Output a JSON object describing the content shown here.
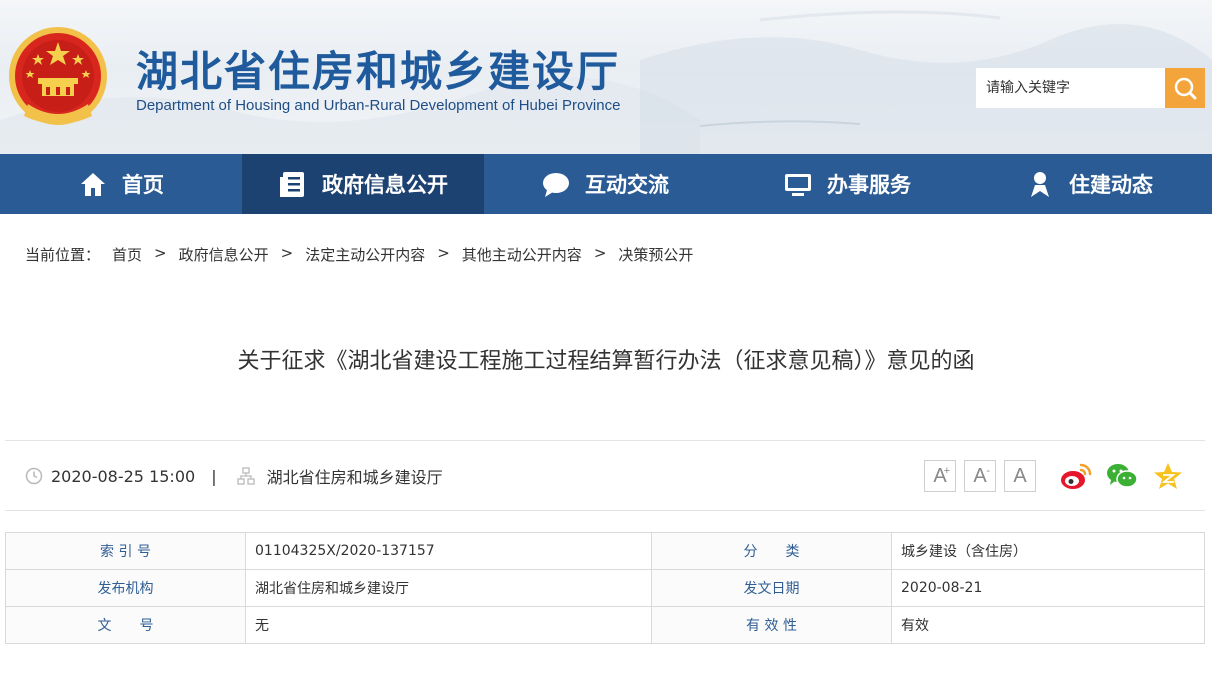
{
  "header": {
    "title": "湖北省住房和城乡建设厅",
    "subtitle": "Department of Housing and Urban-Rural Development of Hubei Province",
    "search_placeholder": "请输入关键字"
  },
  "nav": {
    "items": [
      {
        "label": "首页",
        "icon": "home-icon"
      },
      {
        "label": "政府信息公开",
        "icon": "document-list-icon"
      },
      {
        "label": "互动交流",
        "icon": "chat-bubble-icon"
      },
      {
        "label": "办事服务",
        "icon": "monitor-icon"
      },
      {
        "label": "住建动态",
        "icon": "person-badge-icon"
      }
    ],
    "active_index": 1
  },
  "breadcrumb": {
    "prefix": "当前位置：",
    "items": [
      "首页",
      "政府信息公开",
      "法定主动公开内容",
      "其他主动公开内容",
      "决策预公开"
    ],
    "separator": ">"
  },
  "article": {
    "title": "关于征求《湖北省建设工程施工过程结算暂行办法（征求意见稿）》意见的函",
    "datetime": "2020-08-25 15:00",
    "divider": "|",
    "publisher": "湖北省住房和城乡建设厅"
  },
  "font_controls": {
    "increase": "A",
    "increase_mark": "+",
    "decrease": "A",
    "decrease_mark": "-",
    "reset": "A"
  },
  "share_icons": [
    "weibo-icon",
    "wechat-icon",
    "qzone-icon"
  ],
  "info_table": {
    "rows": [
      {
        "k1": "索 引 号",
        "v1": "01104325X/2020-137157",
        "k2": "分　　类",
        "v2": "城乡建设（含住房）"
      },
      {
        "k1": "发布机构",
        "v1": "湖北省住房和城乡建设厅",
        "k2": "发文日期",
        "v2": "2020-08-21"
      },
      {
        "k1": "文　　号",
        "v1": "无",
        "k2": "有 效 性",
        "v2": "有效"
      }
    ]
  },
  "colors": {
    "brand": "#1f5a9c",
    "nav": "#2b5b95",
    "nav_active": "#1c4272",
    "search_button": "#f3a43a",
    "table_key": "#2f5e94"
  }
}
